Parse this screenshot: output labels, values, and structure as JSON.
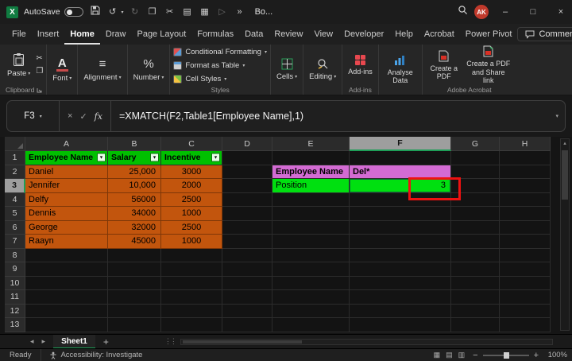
{
  "colors": {
    "accent_green": "#1E9E57",
    "tab_underline": "#E2E2E2",
    "header_green": "#00C000",
    "cell_green": "#00E010",
    "magenta": "#D36BD3",
    "orange": "#C2550D",
    "annotation_red": "#EE1111",
    "addins_red": "#E8484F",
    "share_green": "#37A660",
    "avatar_red": "#C0392B"
  },
  "glyphs": {
    "dropdown": "▾",
    "undo": "↺",
    "redo": "↻",
    "copy": "❐",
    "cut": "✂",
    "doc": "▤",
    "table": "▦",
    "play": "▷",
    "overflow": "»",
    "minimize": "–",
    "maximize": "□",
    "close": "×",
    "cancel": "×",
    "check": "✓",
    "fx": "fx",
    "filter": "▾",
    "nav_left": "◂",
    "nav_right": "▸",
    "vup": "▴",
    "dots": "⋮⋮",
    "align": "≡",
    "percent": "%",
    "font_letter": "A",
    "logo_letter": "X",
    "view_normal": "▦",
    "view_layout": "▤",
    "view_break": "▥",
    "zoom_out": "−",
    "zoom_in": "+",
    "add_sheet": "+"
  },
  "window": {
    "autosave_label": "AutoSave",
    "doc_title": "Bo...",
    "avatar_initials": "AK"
  },
  "ribbon": {
    "tabs": [
      "File",
      "Insert",
      "Home",
      "Draw",
      "Page Layout",
      "Formulas",
      "Data",
      "Review",
      "View",
      "Developer",
      "Help",
      "Acrobat",
      "Power Pivot"
    ],
    "active_tab": "Home",
    "comments_label": "Comments",
    "paste": "Paste",
    "font": "Font",
    "alignment": "Alignment",
    "number": "Number",
    "styles": {
      "conditional": "Conditional Formatting",
      "format_table": "Format as Table",
      "cell_styles": "Cell Styles",
      "group_label": "Styles"
    },
    "cells": "Cells",
    "editing": "Editing",
    "addins_label": "Add-ins",
    "addins_group_label": "Add-ins",
    "analyse": "Analyse Data",
    "create_pdf": "Create a PDF",
    "create_pdf_share": "Create a PDF and Share link",
    "clipboard_group_label": "Clipboard",
    "adobe_group_label": "Adobe Acrobat"
  },
  "formula_bar": {
    "name_box": "F3",
    "formula": "=XMATCH(F2,Table1[Employee Name],1)"
  },
  "sheet": {
    "col_headers": [
      "A",
      "B",
      "C",
      "D",
      "E",
      "F",
      "G",
      "H"
    ],
    "visible_rows": 13,
    "selected_cell": "F3",
    "selected_col": "F",
    "selected_row": 3,
    "cells": [
      {
        "r": 1,
        "c": "A",
        "text": "Employee Name",
        "style": "thdr",
        "filter": true
      },
      {
        "r": 1,
        "c": "B",
        "text": "Salary",
        "style": "thdr",
        "filter": true
      },
      {
        "r": 1,
        "c": "C",
        "text": "Incentive",
        "style": "thdr",
        "filter": true
      },
      {
        "r": 2,
        "c": "A",
        "text": "Daniel",
        "style": "orange"
      },
      {
        "r": 2,
        "c": "B",
        "text": "25,000",
        "style": "orange",
        "align": "right"
      },
      {
        "r": 2,
        "c": "C",
        "text": "3000",
        "style": "orange",
        "align": "center"
      },
      {
        "r": 3,
        "c": "A",
        "text": "Jennifer",
        "style": "orange"
      },
      {
        "r": 3,
        "c": "B",
        "text": "10,000",
        "style": "orange",
        "align": "right"
      },
      {
        "r": 3,
        "c": "C",
        "text": "2000",
        "style": "orange",
        "align": "center"
      },
      {
        "r": 4,
        "c": "A",
        "text": "Delfy",
        "style": "orange"
      },
      {
        "r": 4,
        "c": "B",
        "text": "56000",
        "style": "orange",
        "align": "right"
      },
      {
        "r": 4,
        "c": "C",
        "text": "2500",
        "style": "orange",
        "align": "center"
      },
      {
        "r": 5,
        "c": "A",
        "text": "Dennis",
        "style": "orange"
      },
      {
        "r": 5,
        "c": "B",
        "text": "34000",
        "style": "orange",
        "align": "right"
      },
      {
        "r": 5,
        "c": "C",
        "text": "1000",
        "style": "orange",
        "align": "center"
      },
      {
        "r": 6,
        "c": "A",
        "text": "George",
        "style": "orange"
      },
      {
        "r": 6,
        "c": "B",
        "text": "32000",
        "style": "orange",
        "align": "right"
      },
      {
        "r": 6,
        "c": "C",
        "text": "2500",
        "style": "orange",
        "align": "center"
      },
      {
        "r": 7,
        "c": "A",
        "text": "Raayn",
        "style": "orange"
      },
      {
        "r": 7,
        "c": "B",
        "text": "45000",
        "style": "orange",
        "align": "right"
      },
      {
        "r": 7,
        "c": "C",
        "text": "1000",
        "style": "orange",
        "align": "center"
      },
      {
        "r": 2,
        "c": "E",
        "text": "Employee Name",
        "style": "magenta"
      },
      {
        "r": 2,
        "c": "F",
        "text": "Del*",
        "style": "magenta",
        "bold": true
      },
      {
        "r": 3,
        "c": "E",
        "text": "Position",
        "style": "green"
      },
      {
        "r": 3,
        "c": "F",
        "text": "3",
        "style": "green",
        "align": "right",
        "selected": true
      }
    ]
  },
  "sheet_tabs": {
    "active": "Sheet1"
  },
  "status_bar": {
    "ready": "Ready",
    "accessibility": "Accessibility: Investigate",
    "zoom": "100%"
  }
}
